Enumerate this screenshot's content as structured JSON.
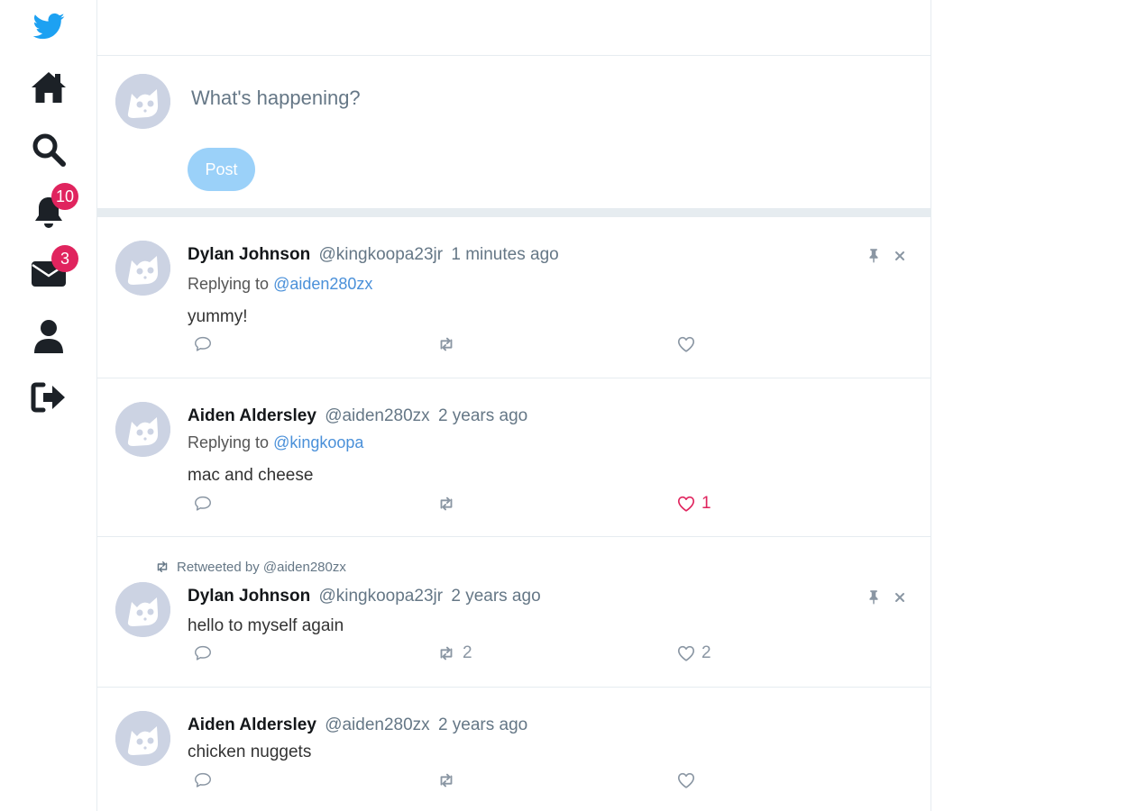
{
  "compose": {
    "placeholder": "What's happening?",
    "post_label": "Post"
  },
  "badges": {
    "notifications": "10",
    "messages": "3"
  },
  "colors": {
    "accent": "#1da1f2",
    "like": "#e0245e",
    "post_button": "#9bd1f9",
    "link": "#4a90d9"
  },
  "icons": [
    "bird-logo-icon",
    "home-icon",
    "search-icon",
    "bell-icon",
    "envelope-icon",
    "user-icon",
    "sign-out-icon",
    "comment-icon",
    "retweet-icon",
    "heart-icon",
    "pin-icon",
    "close-icon"
  ],
  "posts": [
    {
      "name": "Dylan Johnson",
      "handle": "@kingkoopa23jr",
      "time": "1 minutes ago",
      "reply_prefix": "Replying to",
      "reply_to": "@aiden280zx",
      "content": "yummy!",
      "retweets": "",
      "likes": ""
    },
    {
      "name": "Aiden Aldersley",
      "handle": "@aiden280zx",
      "time": "2 years ago",
      "reply_prefix": "Replying to",
      "reply_to": "@kingkoopa",
      "content": "mac and cheese",
      "retweets": "",
      "likes": "1"
    },
    {
      "retweeted_by": "Retweeted by @aiden280zx",
      "name": "Dylan Johnson",
      "handle": "@kingkoopa23jr",
      "time": "2 years ago",
      "content": "hello to myself again",
      "retweets": "2",
      "likes": "2"
    },
    {
      "name": "Aiden Aldersley",
      "handle": "@aiden280zx",
      "time": "2 years ago",
      "content": "chicken nuggets",
      "retweets": "",
      "likes": ""
    }
  ]
}
